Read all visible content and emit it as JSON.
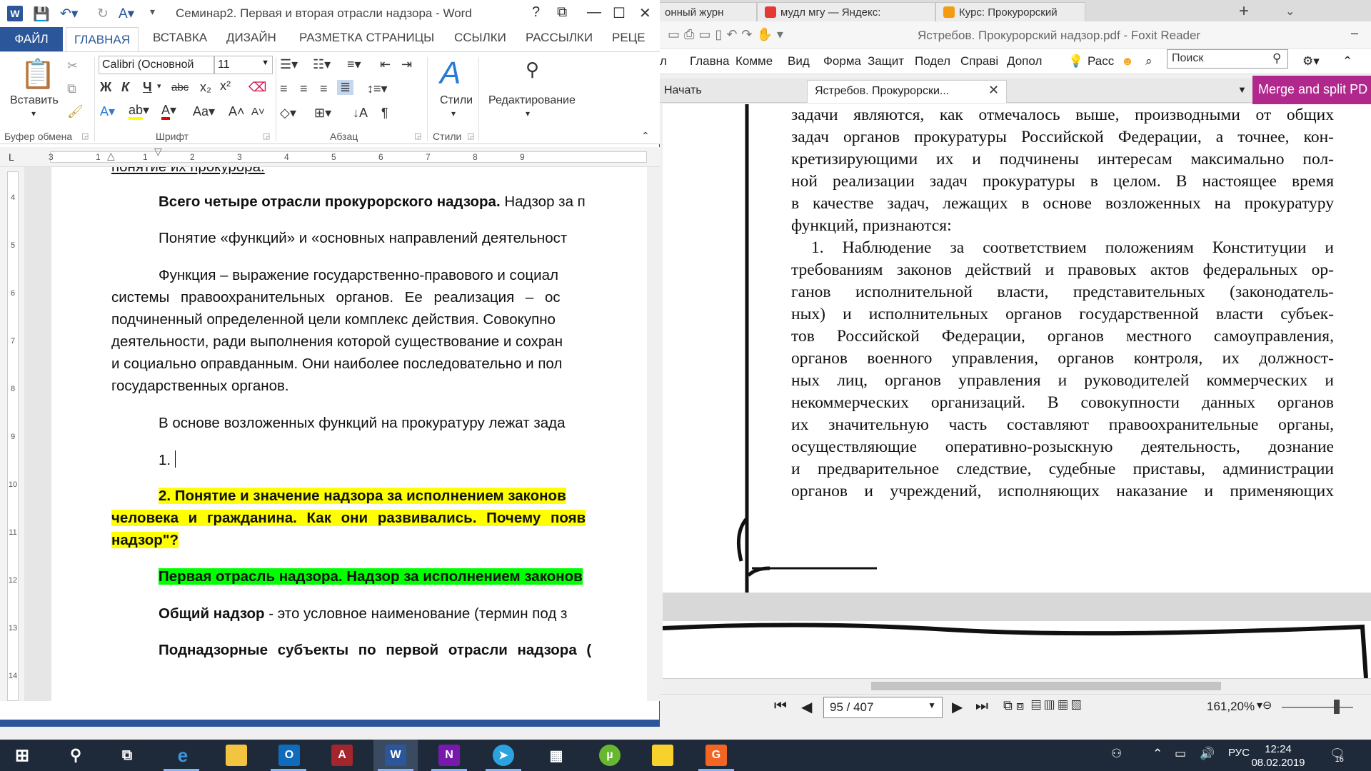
{
  "browser_tabs": [
    {
      "label": "онный журн",
      "color": "#4a8fe7"
    },
    {
      "label": "мудл мгу — Яндекс:",
      "color": "#e53935"
    },
    {
      "label": "Курс: Прокурорский",
      "color": "#f39c12"
    }
  ],
  "foxit": {
    "title": "Ястребов. Прокурорский надзор.pdf - Foxit Reader",
    "menu": [
      "л",
      "Главна",
      "Комме",
      "Вид",
      "Форма",
      "Защит",
      "Подел",
      "Справі",
      "Допол",
      "Расс"
    ],
    "search_placeholder": "Поиск",
    "start_label": "Начать",
    "doc_tab": "Ястребов. Прокурорски...",
    "merge_label": "Merge and split PD",
    "page_current": "95 / 407",
    "zoom": "161,20%",
    "pdf_lines": [
      "задачи являются, как отмечалось выше, производными от общих",
      "задач органов прокуратуры Российской Федерации, а точнее, кон-",
      "кретизирующими их и подчинены интересам максимально пол-",
      "ной реализации задач прокуратуры в целом. В настоящее время",
      "в качестве задач, лежащих в основе возложенных на прокуратуру",
      "функций, признаются:",
      "1. Наблюдение за соответствием положениям Конституции и",
      "требованиям законов действий и правовых актов федеральных ор-",
      "ганов исполнительной власти, представительных (законодатель-",
      "ных) и исполнительных органов государственной власти субъек-",
      "тов Российской Федерации, органов местного самоуправления,",
      "органов военного управления, органов контроля, их должност-",
      "ных лиц, органов управления и руководителей коммерческих и",
      "некоммерческих организаций. В совокупности данных органов",
      "их значительную часть составляют правоохранительные органы,",
      "осуществляющие оперативно-розыскную деятельность, дознание",
      "и предварительное следствие, судебные приставы, администрации",
      "органов и учреждений, исполняющих наказание и применяющих"
    ]
  },
  "word": {
    "title": "Семинар2. Первая и вторая отрасли надзора - Word",
    "logo": "W",
    "tabs": [
      "ФАЙЛ",
      "ГЛАВНАЯ",
      "ВСТАВКА",
      "ДИЗАЙН",
      "РАЗМЕТКА СТРАНИЦЫ",
      "ССЫЛКИ",
      "РАССЫЛКИ",
      "РЕЦЕ"
    ],
    "font_name": "Calibri (Основной",
    "font_size": "11",
    "paste_label": "Вставить",
    "styles_label": "Стили",
    "editing_label": "Редактирование",
    "group_labels": [
      "Буфер обмена",
      "Шрифт",
      "Абзац",
      "Стили"
    ],
    "ruler_numbers": [
      "3",
      "1",
      "1",
      "2",
      "3",
      "4",
      "5",
      "6",
      "7",
      "8",
      "9"
    ],
    "vruler_numbers": [
      "4",
      "5",
      "6",
      "7",
      "8",
      "9",
      "10",
      "11",
      "12",
      "13",
      "14"
    ],
    "doc": {
      "top_cut": "понятие их прокурора.",
      "p1_bold": "Всего четыре отрасли прокурорского надзора.",
      "p1_rest": " Надзор за п",
      "p2": "Понятие «функций» и «основных направлений деятельност",
      "p3_l1": "Функция – выражение государственно-правового и социал",
      "p3_l2": "системы правоохранительных органов. Ее реализация – ос",
      "p3_l3": "подчиненный определенной цели комплекс действия. Совокупно",
      "p3_l4": "деятельности, ради выполнения которой существование и сохран",
      "p3_l5": "и социально оправданным. Они наиболее последовательно и пол",
      "p3_l6": "государственных органов.",
      "p4": "В основе возложенных функций на прокуратуру лежат зада",
      "p5": "1.",
      "h2_l1": "2. Понятие и значение надзора за исполнением законов",
      "h2_l2": "человека и гражданина. Как они развивались. Почему появ",
      "h2_l3": "надзор\"?",
      "g1": "Первая отрасль надзора. Надзор за исполнением законов",
      "p6_bold": "Общий надзор",
      "p6_rest": " - это условное наименование (термин под з",
      "p7": "Поднадзорные субъекты по первой отрасли надзора ("
    }
  },
  "taskbar": {
    "time": "12:24",
    "date": "08.02.2019",
    "lang": "РУС",
    "notif_count": "16"
  }
}
